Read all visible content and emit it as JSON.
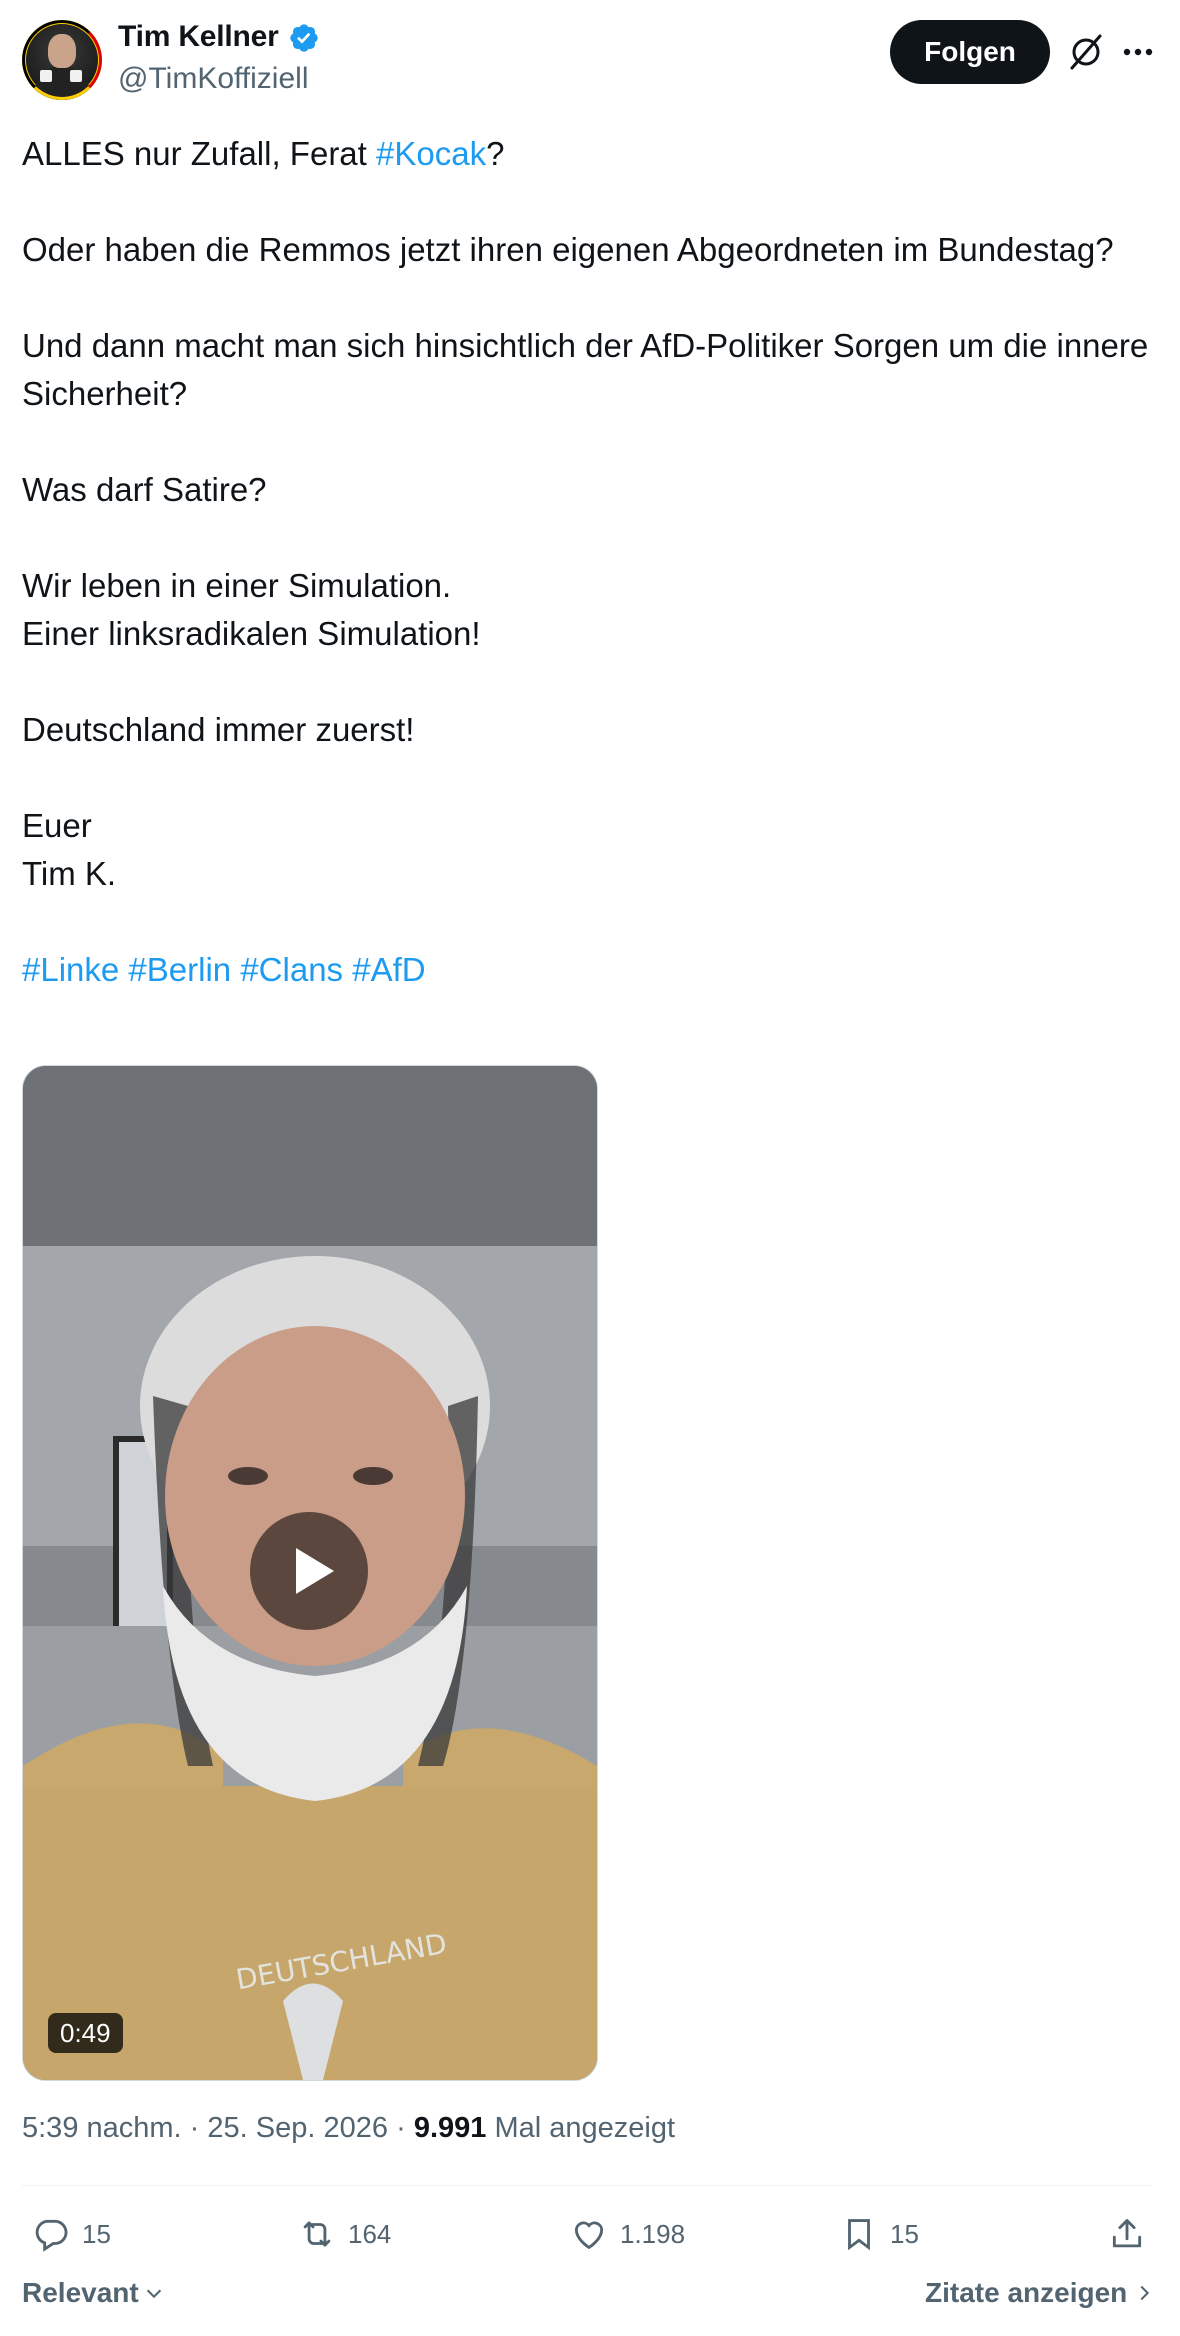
{
  "author": {
    "name": "Tim Kellner",
    "handle": "@TimKoffiziell",
    "verified": true
  },
  "header": {
    "follow_label": "Folgen",
    "icons": [
      "grok-icon",
      "more-icon"
    ]
  },
  "tweet": {
    "paragraphs": [
      {
        "segments": [
          {
            "text": "ALLES nur Zufall, Ferat "
          },
          {
            "text": "#Kocak",
            "hashtag": true
          },
          {
            "text": "?"
          }
        ]
      },
      {
        "segments": [
          {
            "text": "Oder haben die Remmos jetzt ihren eigenen Abgeordneten im Bundestag?"
          }
        ]
      },
      {
        "segments": [
          {
            "text": "Und dann macht man sich hinsichtlich der AfD-Politiker Sorgen um die innere Sicherheit?"
          }
        ]
      },
      {
        "segments": [
          {
            "text": "Was darf Satire?"
          }
        ]
      },
      {
        "segments": [
          {
            "text": "Wir leben in einer Simulation.\nEiner linksradikalen Simulation!"
          }
        ]
      },
      {
        "segments": [
          {
            "text": "Deutschland immer zuerst!"
          }
        ]
      },
      {
        "segments": [
          {
            "text": "Euer\nTim K."
          }
        ]
      },
      {
        "segments": [
          {
            "text": "#Linke",
            "hashtag": true
          },
          {
            "text": " "
          },
          {
            "text": "#Berlin",
            "hashtag": true
          },
          {
            "text": " "
          },
          {
            "text": "#Clans",
            "hashtag": true
          },
          {
            "text": " "
          },
          {
            "text": "#AfD",
            "hashtag": true
          }
        ]
      }
    ]
  },
  "video": {
    "duration": "0:49",
    "shirt_text": "DEUTSCHLAND"
  },
  "meta": {
    "time": "5:39 nachm.",
    "separator": "·",
    "date": "25. Sep. 2026",
    "views": "9.991",
    "views_label": "Mal angezeigt"
  },
  "actions": {
    "replies": "15",
    "reposts": "164",
    "likes": "1.198",
    "bookmarks": "15"
  },
  "footer": {
    "sort_label": "Relevant",
    "quotes_label": "Zitate anzeigen"
  },
  "colors": {
    "accent": "#1d9bf0",
    "text": "#0f1419",
    "muted": "#536471"
  }
}
